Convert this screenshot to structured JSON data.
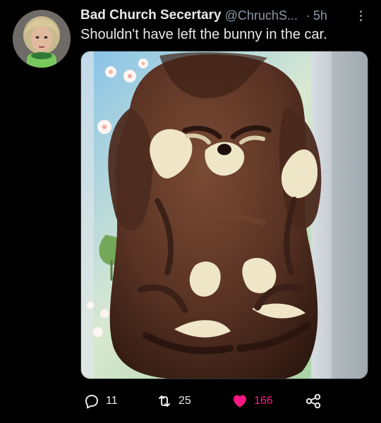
{
  "tweet": {
    "author_name": "Bad Church Secertary",
    "handle": "@ChruchS...",
    "separator": "·",
    "time": "5h",
    "text": "Shouldn't have left the bunny in the car.",
    "media_description": ""
  },
  "actions": {
    "replies": "11",
    "retweets": "25",
    "likes": "166",
    "liked": true
  },
  "colors": {
    "background": "#000000",
    "text": "#e7e9ea",
    "muted": "#8b98a5",
    "like": "#f91880",
    "chocolate": "#5a3324",
    "white_chocolate": "#efe6c7"
  },
  "icons": [
    "avatar",
    "more-icon",
    "reply-icon",
    "retweet-icon",
    "heart-icon",
    "share-icon"
  ]
}
